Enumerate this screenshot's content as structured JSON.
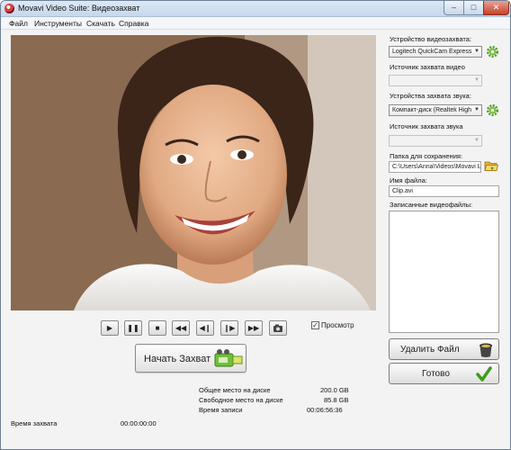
{
  "window": {
    "title": "Movavi Video Suite: Видеозахват",
    "controls": {
      "minimize": "–",
      "maximize": "□",
      "close": "✕"
    }
  },
  "menu": [
    "Файл",
    "Инструменты",
    "Скачать",
    "Справка"
  ],
  "player": {
    "preview_label": "Просмотр",
    "preview_checked": true,
    "controls": [
      "play-icon",
      "pause-icon",
      "stop-icon",
      "rewind-icon",
      "step-back-icon",
      "step-forward-icon",
      "fast-forward-icon",
      "camera-snapshot-icon"
    ]
  },
  "capture_button": {
    "label": "Начать Захват",
    "icon": "video-camera-icon"
  },
  "stats": {
    "total_space_label": "Общее место на диске",
    "total_space_value": "200.0 GB",
    "free_space_label": "Свободное место на диске",
    "free_space_value": "85.8 GB",
    "record_time_label": "Время записи",
    "record_time_value": "00:06:56:36",
    "capture_time_label": "Время захвата",
    "capture_time_value": "00:00:00:00"
  },
  "panel": {
    "video_device_label": "Устройство видеозахвата:",
    "video_device_value": "Logitech QuickCam Express",
    "video_source_label": "Источник захвата видео",
    "video_source_value": "",
    "audio_device_label": "Устройства захвата звука:",
    "audio_device_value": "Компакт-диск (Realtek High",
    "audio_source_label": "Источник захвата звука",
    "audio_source_value": "",
    "save_folder_label": "Папка для сохранения:",
    "save_folder_value": "C:\\Users\\Anna\\Videos\\Movavi L",
    "file_name_label": "Имя файла:",
    "file_name_value": "Clip.avi",
    "recorded_files_label": "Записанные видеофайлы:"
  },
  "buttons": {
    "delete_file": "Удалить Файл",
    "done": "Готово"
  },
  "colors": {
    "titlebar": "#c6d8ec",
    "gear_green": "#5aa02c",
    "done_check": "#3f9a1f",
    "folder": "#e4b338",
    "camera_body": "#6fbf3a"
  }
}
